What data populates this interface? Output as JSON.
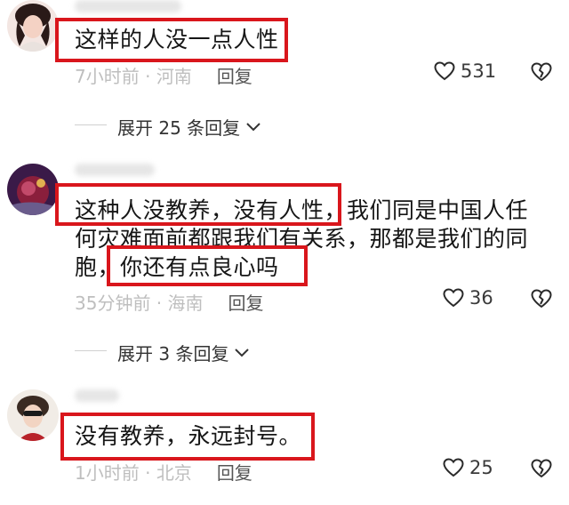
{
  "comments": [
    {
      "text": "这样的人没一点人性",
      "time": "7小时前",
      "location": "河南",
      "reply_label": "回复",
      "likes": "531"
    },
    {
      "text_line1": "这种人没教养，没有人性，我们同是中国人任",
      "text_line2": "何灾难面前都跟我们有关系，那都是我们的同",
      "text_line3": "胞，你还有点良心吗",
      "time": "35分钟前",
      "location": "海南",
      "reply_label": "回复",
      "likes": "36"
    },
    {
      "text": "没有教养，永远封号。",
      "time": "1小时前",
      "location": "北京",
      "reply_label": "回复",
      "likes": "25"
    }
  ],
  "expand": [
    {
      "label": "展开 25 条回复"
    },
    {
      "label": "展开 3 条回复"
    }
  ],
  "meta_separator": " · ",
  "colors": {
    "highlight": "#d9161c",
    "meta": "#8a8a8a"
  },
  "icons": {
    "like": "heart-outline-icon",
    "dislike": "broken-heart-icon",
    "expand": "chevron-down-icon"
  }
}
